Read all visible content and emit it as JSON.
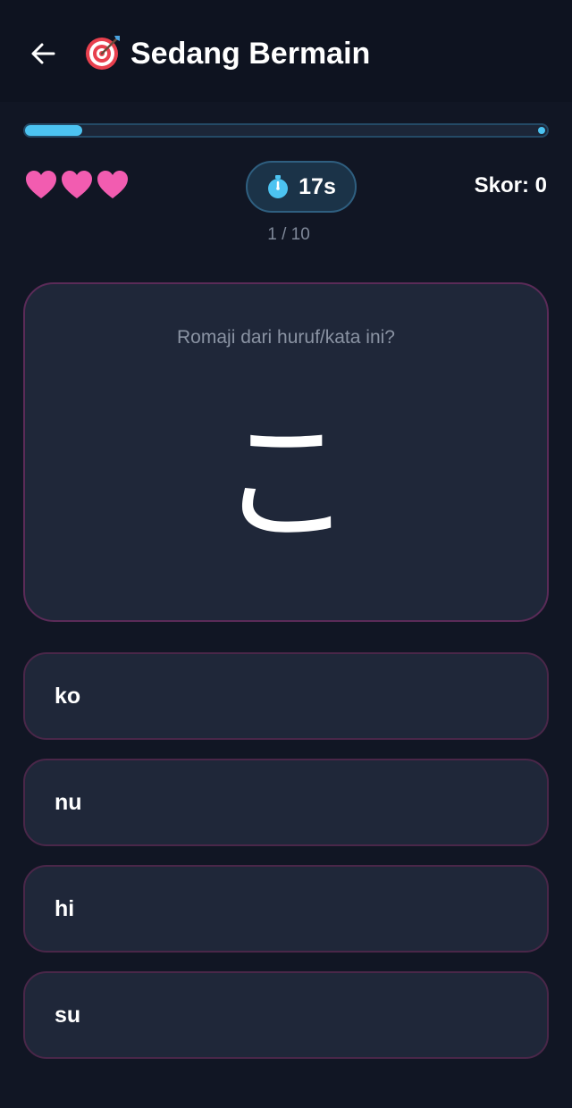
{
  "header": {
    "title": "Sedang Bermain",
    "back_icon": "arrow-left-icon",
    "title_icon": "target-icon"
  },
  "progress": {
    "current": 1,
    "total": 10,
    "fraction": 0.11,
    "color": "#4cc3f1"
  },
  "status": {
    "lives": 3,
    "heart_color": "#f25cb0",
    "timer_label": "17s",
    "timer_icon": "stopwatch-icon",
    "score_label": "Skor: 0",
    "counter_label": "1 / 10"
  },
  "question": {
    "prompt": "Romaji dari huruf/kata ini?",
    "character": "こ"
  },
  "options": [
    {
      "label": "ko"
    },
    {
      "label": "nu"
    },
    {
      "label": "hi"
    },
    {
      "label": "su"
    }
  ],
  "colors": {
    "background": "#111624",
    "card": "#1f2739",
    "card_border": "#5b2b58",
    "accent": "#4cc3f1"
  }
}
